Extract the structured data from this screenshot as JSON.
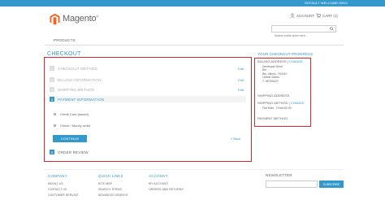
{
  "header": {
    "welcome": "DEFAULT WELCOME MSG!",
    "logo_text": "Magento",
    "logo_mark": "®",
    "account_label": "ACCOUNT",
    "cart_label": "CART (1)",
    "search_placeholder": "Search entire store here..."
  },
  "nav": {
    "products": "PRODUCTS"
  },
  "checkout": {
    "title": "CHECKOUT",
    "steps": [
      {
        "num": "1",
        "label": "CHECKOUT METHOD",
        "edit": "Edit"
      },
      {
        "num": "2",
        "label": "BILLING INFORMATION",
        "edit": "Edit"
      },
      {
        "num": "3",
        "label": "SHIPPING METHOD",
        "edit": "Edit"
      },
      {
        "num": "4",
        "label": "PAYMENT INFORMATION"
      },
      {
        "num": "5",
        "label": "ORDER REVIEW"
      }
    ],
    "payment_options": [
      "Credit Card (saved)",
      "Check / Money order"
    ],
    "continue_label": "CONTINUE",
    "back_label": "« Back"
  },
  "progress": {
    "title": "YOUR CHECKOUT PROGRESS",
    "billing_label": "BILLING ADDRESS",
    "change": "CHANGE",
    "billing_lines": [
      "Developer Stork",
      "Bin",
      "Bin, Illinois, 762410",
      "United States",
      "T: 98765420"
    ],
    "shipping_address": "SHIPPING ADDRESS",
    "shipping_method": "SHIPPING METHOD",
    "shipping_rate": "Flat Rate - Fixed $5.00",
    "payment_method": "PAYMENT METHOD"
  },
  "footer": {
    "company": {
      "heading": "COMPANY",
      "items": [
        "ABOUT US",
        "CONTACT US",
        "CUSTOMER SERVICE"
      ]
    },
    "quick_links": {
      "heading": "QUICK LINKS",
      "items": [
        "SITE MAP",
        "SEARCH TERMS",
        "ADVANCED SEARCH"
      ]
    },
    "account": {
      "heading": "ACCOUNT",
      "items": [
        "MY ACCOUNT",
        "ORDERS AND RETURNS"
      ]
    },
    "newsletter": "NEWSLETTER",
    "subscribe": "SUBSCRIBE"
  },
  "colors": {
    "accent": "#3399cc",
    "highlight": "#d82a2a"
  }
}
